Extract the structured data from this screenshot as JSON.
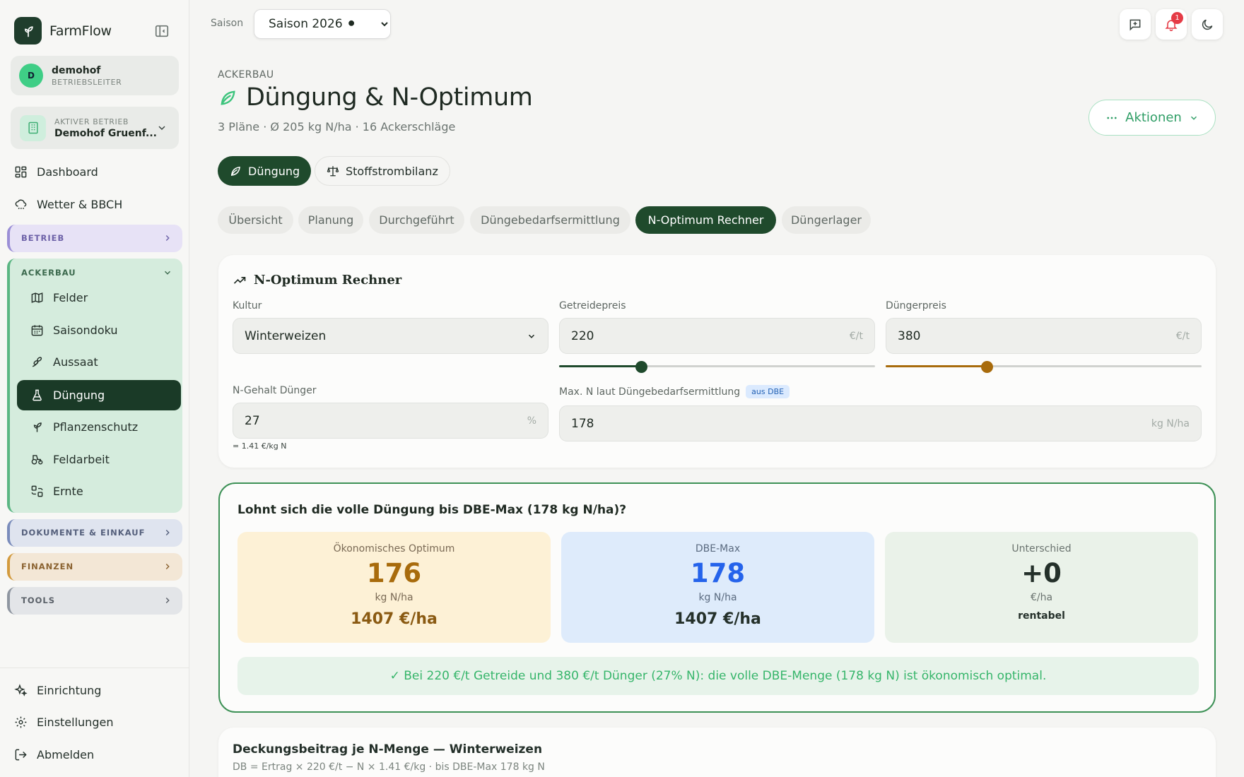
{
  "app": {
    "name": "FarmFlow"
  },
  "user": {
    "initial": "D",
    "name": "demohof",
    "role": "BETRIEBSLEITER"
  },
  "farm": {
    "label": "AKTIVER BETRIEB",
    "name": "Demohof Gruenf..."
  },
  "nav": {
    "dashboard": "Dashboard",
    "weather": "Wetter & BBCH"
  },
  "groups": {
    "betrieb": "BETRIEB",
    "ackerbau": "ACKERBAU",
    "dokumente": "DOKUMENTE & EINKAUF",
    "finanzen": "FINANZEN",
    "tools": "TOOLS"
  },
  "ackerbau_items": [
    "Felder",
    "Saisondoku",
    "Aussaat",
    "Düngung",
    "Pflanzenschutz",
    "Feldarbeit",
    "Ernte"
  ],
  "bottom_nav": {
    "setup": "Einrichtung",
    "settings": "Einstellungen",
    "logout": "Abmelden"
  },
  "topbar": {
    "season_label": "Saison",
    "season_value": "Saison 2026 ⚫",
    "notifications": "1"
  },
  "page": {
    "eyebrow": "ACKERBAU",
    "title": "Düngung & N-Optimum",
    "subtitle": "3 Pläne · Ø 205 kg N/ha · 16 Ackerschläge",
    "actions": "Aktionen"
  },
  "segments": [
    "Düngung",
    "Stoffstrombilanz"
  ],
  "tabs": [
    "Übersicht",
    "Planung",
    "Durchgeführt",
    "Düngebedarfsermittlung",
    "N-Optimum Rechner",
    "Düngerlager"
  ],
  "calculator": {
    "title": "N-Optimum Rechner",
    "kultur_label": "Kultur",
    "kultur_value": "Winterweizen",
    "grain_label": "Getreidepreis",
    "grain_value": "220",
    "grain_unit": "€/t",
    "grain_slider": 0.26,
    "fert_label": "Düngerpreis",
    "fert_value": "380",
    "fert_unit": "€/t",
    "fert_slider": 0.32,
    "n_label": "N-Gehalt Dünger",
    "n_value": "27",
    "n_unit": "%",
    "n_hint": "= 1.41 €/kg N",
    "max_label": "Max. N laut Düngebedarfsermittlung",
    "max_tag": "aus DBE",
    "max_value": "178",
    "max_unit": "kg N/ha"
  },
  "result": {
    "question": "Lohnt sich die volle Düngung bis DBE-Max (178 kg N/ha)?",
    "opt": {
      "label": "Ökonomisches Optimum",
      "value": "176",
      "unit": "kg N/ha",
      "money": "1407 €/ha"
    },
    "dbe": {
      "label": "DBE-Max",
      "value": "178",
      "unit": "kg N/ha",
      "money": "1407 €/ha"
    },
    "diff": {
      "label": "Unterschied",
      "value": "+0",
      "unit": "€/ha",
      "note": "rentabel"
    },
    "banner": "✓ Bei 220 €/t Getreide und 380 €/t Dünger (27% N): die volle DBE-Menge (178 kg N) ist ökonomisch optimal."
  },
  "db_card": {
    "title": "Deckungsbeitrag je N-Menge — Winterweizen",
    "subtitle": "DB = Ertrag × 220 €/t − N × 1.41 €/kg · bis DBE-Max 178 kg N"
  },
  "colors": {
    "accent": "#1f4a2c",
    "green": "#3d9156",
    "orange": "#a86b0c",
    "blue": "#2563eb"
  }
}
